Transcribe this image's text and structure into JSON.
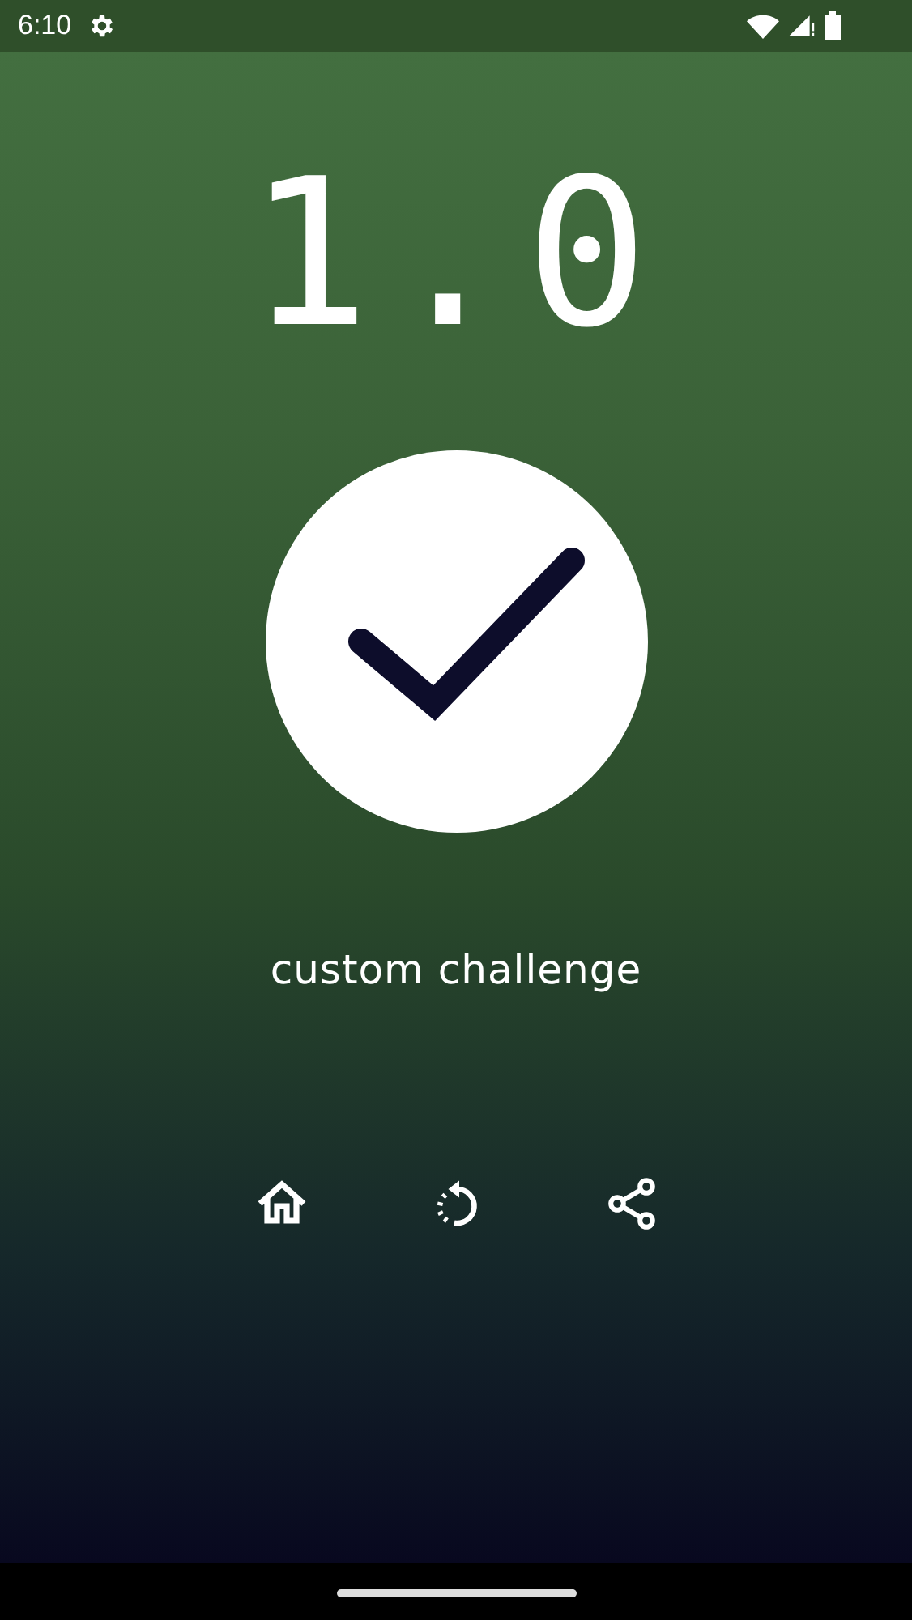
{
  "status_bar": {
    "time": "6:10"
  },
  "score": "1.0",
  "result": {
    "passed": true
  },
  "challenge_name": "custom challenge",
  "actions": [
    {
      "kind": "home"
    },
    {
      "kind": "replay"
    },
    {
      "kind": "share"
    }
  ]
}
